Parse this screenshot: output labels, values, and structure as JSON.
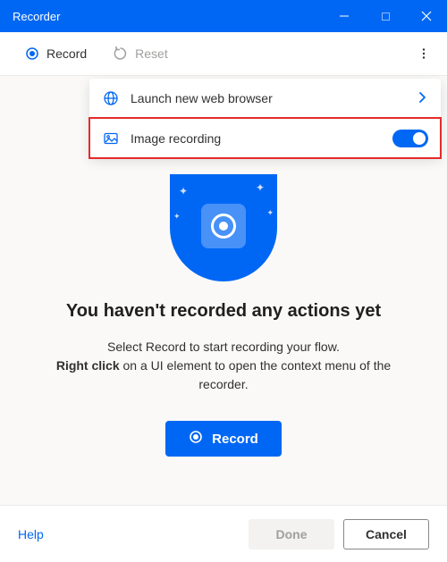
{
  "window": {
    "title": "Recorder"
  },
  "toolbar": {
    "record_label": "Record",
    "reset_label": "Reset"
  },
  "dropdown": {
    "launch_browser_label": "Launch new web browser",
    "image_recording_label": "Image recording",
    "image_recording_on": true
  },
  "empty_state": {
    "title": "You haven't recorded any actions yet",
    "desc_part1": "Select Record to start recording your flow.",
    "desc_bold": "Right click",
    "desc_part2": " on a UI element to open the context menu of the recorder.",
    "record_button": "Record"
  },
  "footer": {
    "help": "Help",
    "done": "Done",
    "cancel": "Cancel"
  },
  "colors": {
    "primary": "#0067f4",
    "highlight": "#e52b2b"
  }
}
